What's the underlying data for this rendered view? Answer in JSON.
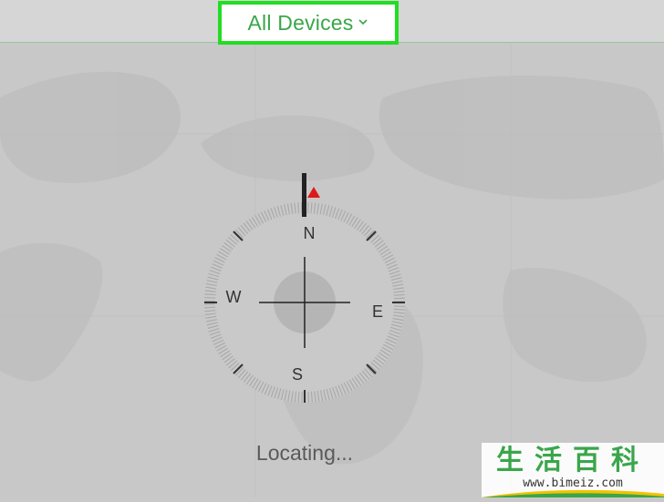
{
  "header": {
    "devices_label": "All Devices",
    "chevron_icon": "chevron-down-icon"
  },
  "compass": {
    "north": "N",
    "south": "S",
    "east": "E",
    "west": "W",
    "needle_color": "#dd1a1a",
    "icon": "compass-icon"
  },
  "status": {
    "text": "Locating..."
  },
  "watermark": {
    "logo_text": "生活百科",
    "url": "www.bimeiz.com"
  },
  "colors": {
    "accent": "#3aa64a",
    "highlight": "#22dd22",
    "map": "#c8c8c8"
  }
}
